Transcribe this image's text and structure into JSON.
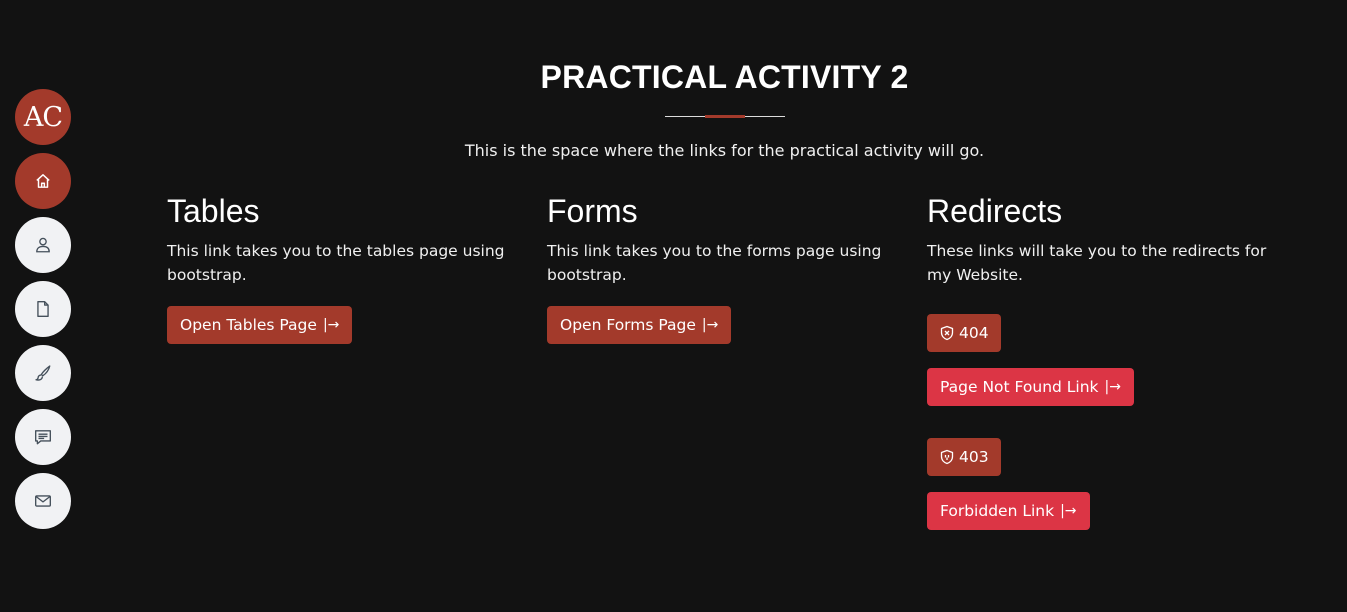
{
  "sidenav": {
    "logo_text": "AC",
    "items": [
      {
        "name": "home",
        "icon": "home-icon",
        "active": true
      },
      {
        "name": "about",
        "icon": "person-icon",
        "active": false
      },
      {
        "name": "resume",
        "icon": "file-icon",
        "active": false
      },
      {
        "name": "portfolio",
        "icon": "brush-icon",
        "active": false
      },
      {
        "name": "services",
        "icon": "chat-icon",
        "active": false
      },
      {
        "name": "contact",
        "icon": "envelope-icon",
        "active": false
      }
    ]
  },
  "header": {
    "title": "PRACTICAL ACTIVITY 2",
    "subtitle": "This is the space where the links for the practical activity will go."
  },
  "columns": {
    "tables": {
      "heading": "Tables",
      "description": "This link takes you to the tables page using bootstrap.",
      "button_label": "Open Tables Page"
    },
    "forms": {
      "heading": "Forms",
      "description": "This link takes you to the forms page using bootstrap.",
      "button_label": "Open Forms Page"
    },
    "redirects": {
      "heading": "Redirects",
      "description": "These links will take you to the redirects for my Website.",
      "items": [
        {
          "badge": "404",
          "link_label": "Page Not Found Link"
        },
        {
          "badge": "403",
          "link_label": "Forbidden Link"
        }
      ]
    }
  },
  "colors": {
    "background": "#121212",
    "accent": "#a33a2b",
    "danger": "#dc3545",
    "nav_inactive": "#f1f2f4"
  }
}
